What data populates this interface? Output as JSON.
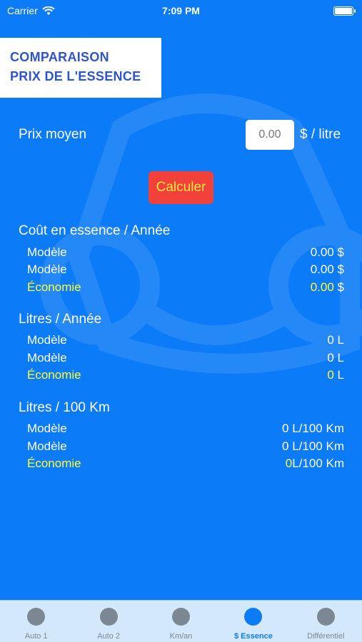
{
  "status_bar": {
    "carrier": "Carrier",
    "time": "7:09 PM"
  },
  "title": {
    "line1": "COMPARAISON",
    "line2": "PRIX DE L'ESSENCE"
  },
  "price": {
    "label": "Prix moyen",
    "value": "0.00",
    "unit": "$ / litre"
  },
  "calculate_label": "Calculer",
  "sections": {
    "cost": {
      "title": "Coût en essence / Année",
      "row1_label": "Modèle",
      "row1_value": "0.00 $",
      "row2_label": "Modèle",
      "row2_value": "0.00 $",
      "savings_label": "Économie",
      "savings_value": "0.00",
      "savings_unit": " $"
    },
    "liters": {
      "title": "Litres / Année",
      "row1_label": "Modèle",
      "row1_value": "0 L",
      "row2_label": "Modèle",
      "row2_value": "0 L",
      "savings_label": "Économie",
      "savings_value": "0",
      "savings_unit": " L"
    },
    "per100": {
      "title": "Litres / 100 Km",
      "row1_label": "Modèle",
      "row1_value": "0 L/100 Km",
      "row2_label": "Modèle",
      "row2_value": "0 L/100 Km",
      "savings_label": "Économie",
      "savings_value": "0",
      "savings_unit": "L/100 Km"
    }
  },
  "tabs": [
    {
      "label": "Auto 1",
      "active": false
    },
    {
      "label": "Auto 2",
      "active": false
    },
    {
      "label": "Km/an",
      "active": false
    },
    {
      "label": "$ Essence",
      "active": true
    },
    {
      "label": "Différentiel",
      "active": false
    }
  ],
  "colors": {
    "background": "#0b7bf7",
    "accent_yellow": "#ffff33",
    "button": "#f2403a",
    "tab_active": "#0a7cf6"
  }
}
